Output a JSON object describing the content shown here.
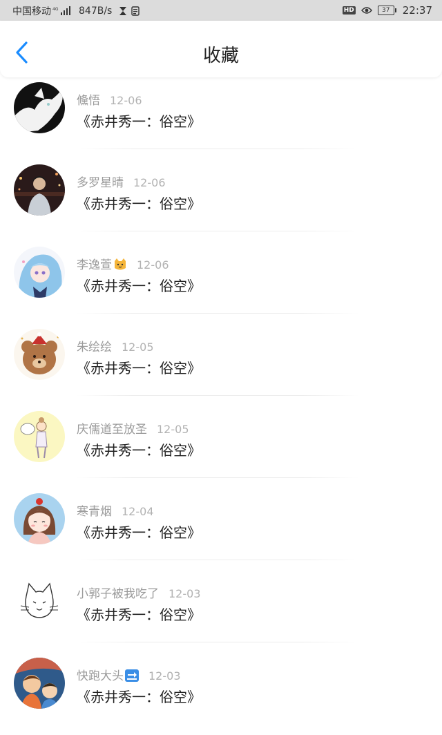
{
  "status_bar": {
    "carrier": "中国移动",
    "network": "4G",
    "speed": "847B/s",
    "hd": "HD",
    "battery": "37",
    "time": "22:37"
  },
  "header": {
    "title": "收藏",
    "back_icon": "chevron-left-icon"
  },
  "accent_color": "#1a8cff",
  "items": [
    {
      "name": "儵悟",
      "date": "12-06",
      "title": "《赤井秀一：俗空》",
      "avatar": "white-cat-avatar",
      "emoji": ""
    },
    {
      "name": "多罗星晴",
      "date": "12-06",
      "title": "《赤井秀一：俗空》",
      "avatar": "night-street-person-avatar",
      "emoji": ""
    },
    {
      "name": "李逸萱",
      "date": "12-06",
      "title": "《赤井秀一：俗空》",
      "avatar": "anime-girl-blue-hair-avatar",
      "emoji": "cat-face-emoji"
    },
    {
      "name": "朱绘绘",
      "date": "12-05",
      "title": "《赤井秀一：俗空》",
      "avatar": "bear-with-hat-avatar",
      "emoji": ""
    },
    {
      "name": "庆儒道至放圣",
      "date": "12-05",
      "title": "《赤井秀一：俗空》",
      "avatar": "cartoon-girl-yellow-avatar",
      "emoji": ""
    },
    {
      "name": "寒青烟",
      "date": "12-04",
      "title": "《赤井秀一：俗空》",
      "avatar": "chibi-girl-blue-avatar",
      "emoji": ""
    },
    {
      "name": "小郭子被我吃了",
      "date": "12-03",
      "title": "《赤井秀一：俗空》",
      "avatar": "sketch-cat-avatar",
      "emoji": ""
    },
    {
      "name": "快跑大头",
      "date": "12-03",
      "title": "《赤井秀一：俗空》",
      "avatar": "two-cartoon-kids-avatar",
      "emoji": "soon-arrow-emoji"
    }
  ]
}
